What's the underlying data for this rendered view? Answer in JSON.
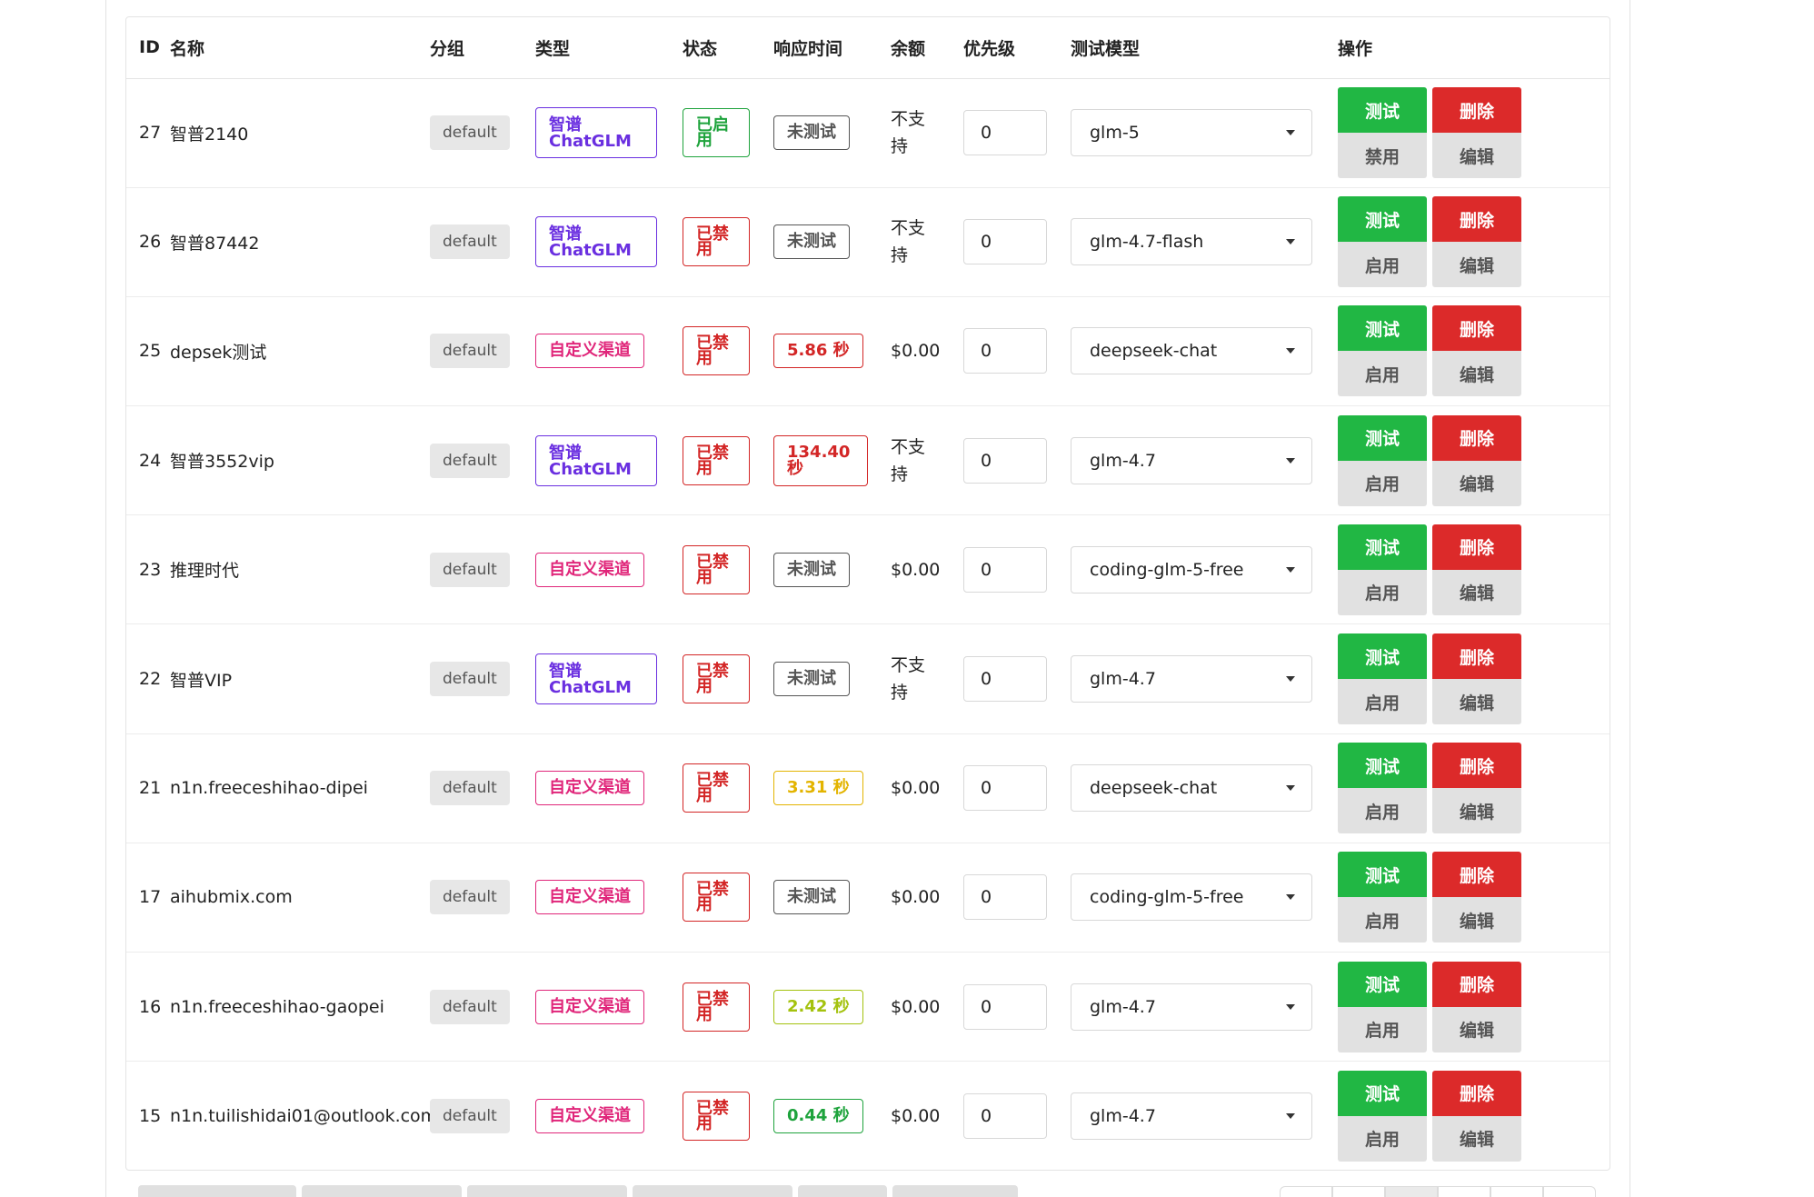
{
  "headers": {
    "id": "ID",
    "name": "名称",
    "group": "分组",
    "type": "类型",
    "status": "状态",
    "response": "响应时间",
    "balance": "余额",
    "priority": "优先级",
    "model": "测试模型",
    "actions": "操作"
  },
  "buttons": {
    "test": "测试",
    "delete": "删除",
    "edit": "编辑"
  },
  "rows": [
    {
      "id": "27",
      "name": "智普2140",
      "group": "default",
      "type": "智谱 ChatGLM",
      "type_kind": "zhipu",
      "status": "已启用",
      "status_kind": "on",
      "response": "未测试",
      "response_kind": "untested",
      "balance": "不支持",
      "priority": "0",
      "model": "glm-5",
      "toggle": "禁用"
    },
    {
      "id": "26",
      "name": "智普87442",
      "group": "default",
      "type": "智谱 ChatGLM",
      "type_kind": "zhipu",
      "status": "已禁用",
      "status_kind": "off",
      "response": "未测试",
      "response_kind": "untested",
      "balance": "不支持",
      "priority": "0",
      "model": "glm-4.7-flash",
      "toggle": "启用"
    },
    {
      "id": "25",
      "name": "depsek测试",
      "group": "default",
      "type": "自定义渠道",
      "type_kind": "custom",
      "status": "已禁用",
      "status_kind": "off",
      "response": "5.86 秒",
      "response_kind": "red",
      "balance": "$0.00",
      "priority": "0",
      "model": "deepseek-chat",
      "toggle": "启用"
    },
    {
      "id": "24",
      "name": "智普3552vip",
      "group": "default",
      "type": "智谱 ChatGLM",
      "type_kind": "zhipu",
      "status": "已禁用",
      "status_kind": "off",
      "response": "134.40 秒",
      "response_kind": "red wrap",
      "balance": "不支持",
      "priority": "0",
      "model": "glm-4.7",
      "toggle": "启用"
    },
    {
      "id": "23",
      "name": "推理时代",
      "group": "default",
      "type": "自定义渠道",
      "type_kind": "custom",
      "status": "已禁用",
      "status_kind": "off",
      "response": "未测试",
      "response_kind": "untested",
      "balance": "$0.00",
      "priority": "0",
      "model": "coding-glm-5-free",
      "toggle": "启用"
    },
    {
      "id": "22",
      "name": "智普VIP",
      "group": "default",
      "type": "智谱 ChatGLM",
      "type_kind": "zhipu",
      "status": "已禁用",
      "status_kind": "off",
      "response": "未测试",
      "response_kind": "untested",
      "balance": "不支持",
      "priority": "0",
      "model": "glm-4.7",
      "toggle": "启用"
    },
    {
      "id": "21",
      "name": "n1n.freeceshihao-dipei",
      "group": "default",
      "type": "自定义渠道",
      "type_kind": "custom",
      "status": "已禁用",
      "status_kind": "off",
      "response": "3.31 秒",
      "response_kind": "yellow",
      "balance": "$0.00",
      "priority": "0",
      "model": "deepseek-chat",
      "toggle": "启用"
    },
    {
      "id": "17",
      "name": "aihubmix.com",
      "group": "default",
      "type": "自定义渠道",
      "type_kind": "custom",
      "status": "已禁用",
      "status_kind": "off",
      "response": "未测试",
      "response_kind": "untested",
      "balance": "$0.00",
      "priority": "0",
      "model": "coding-glm-5-free",
      "toggle": "启用"
    },
    {
      "id": "16",
      "name": "n1n.freeceshihao-gaopei",
      "group": "default",
      "type": "自定义渠道",
      "type_kind": "custom",
      "status": "已禁用",
      "status_kind": "off",
      "response": "2.42 秒",
      "response_kind": "lime",
      "balance": "$0.00",
      "priority": "0",
      "model": "glm-4.7",
      "toggle": "启用"
    },
    {
      "id": "15",
      "name": "n1n.tuilishidai01@outlook.com",
      "group": "default",
      "type": "自定义渠道",
      "type_kind": "custom",
      "status": "已禁用",
      "status_kind": "off",
      "response": "0.44 秒",
      "response_kind": "green",
      "balance": "$0.00",
      "priority": "0",
      "model": "glm-4.7",
      "toggle": "启用"
    }
  ],
  "colors": {
    "test_button": "#21b744",
    "delete_button": "#dc2a2a",
    "zhipu_tag": "#6a2fe0",
    "custom_tag": "#e0267a",
    "enabled": "#1ea33c",
    "disabled": "#d32626"
  }
}
